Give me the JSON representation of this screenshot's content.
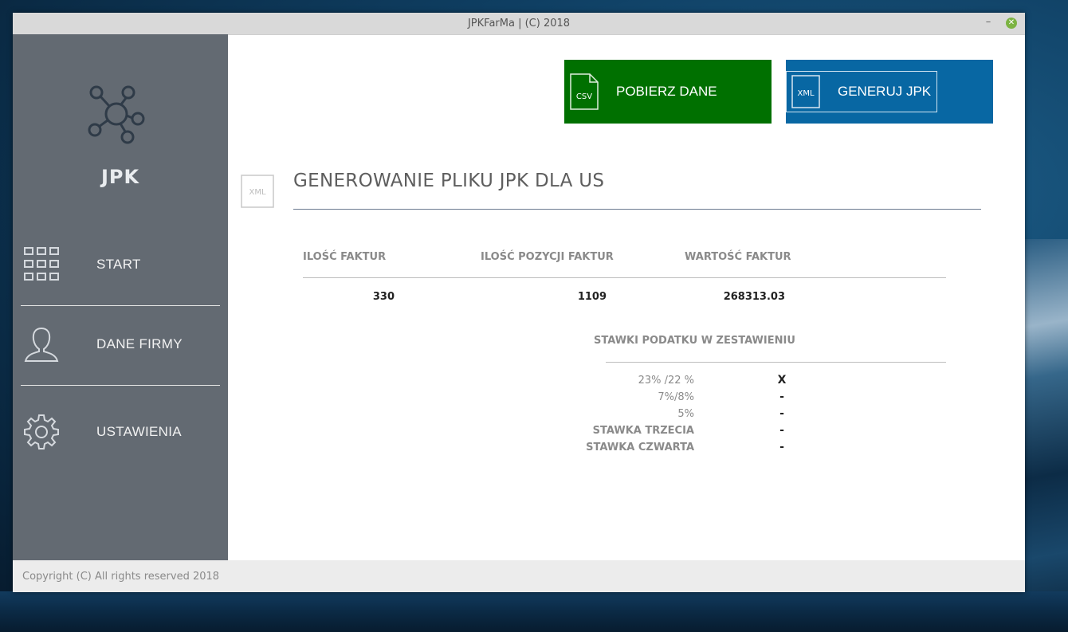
{
  "window": {
    "title": "JPKFarMa | (C) 2018",
    "minimize_symbol": "–",
    "close_symbol": "✕"
  },
  "sidebar": {
    "app_name": "JPK",
    "logo_icon": "network-nodes-icon",
    "items": [
      {
        "label": "START",
        "icon": "grid-icon"
      },
      {
        "label": "DANE FIRMY",
        "icon": "user-icon"
      },
      {
        "label": "USTAWIENIA",
        "icon": "gear-icon"
      }
    ]
  },
  "actions": {
    "download": {
      "label": "POBIERZ DANE",
      "icon_text": "CSV",
      "color": "#007000"
    },
    "generate": {
      "label": "GENERUJ JPK",
      "icon_text": "XML",
      "color": "#0867A3"
    }
  },
  "main": {
    "section_icon_text": "XML",
    "title": "GENEROWANIE PLIKU JPK DLA US",
    "stats": {
      "headers": [
        "ILOŚĆ FAKTUR",
        "ILOŚĆ POZYCJI FAKTUR",
        "WARTOŚĆ FAKTUR"
      ],
      "values": [
        "330",
        "1109",
        "268313.03"
      ]
    },
    "vat": {
      "title": "STAWKI PODATKU W ZESTAWIENIU",
      "rows": [
        {
          "label": "23% /22 %",
          "value": "X"
        },
        {
          "label": "7%/8%",
          "value": "-"
        },
        {
          "label": "5%",
          "value": "-"
        },
        {
          "label": "STAWKA TRZECIA",
          "value": "-"
        },
        {
          "label": "STAWKA CZWARTA",
          "value": "-"
        }
      ]
    }
  },
  "footer": {
    "copyright": "Copyright (C) All rights reserved 2018"
  }
}
